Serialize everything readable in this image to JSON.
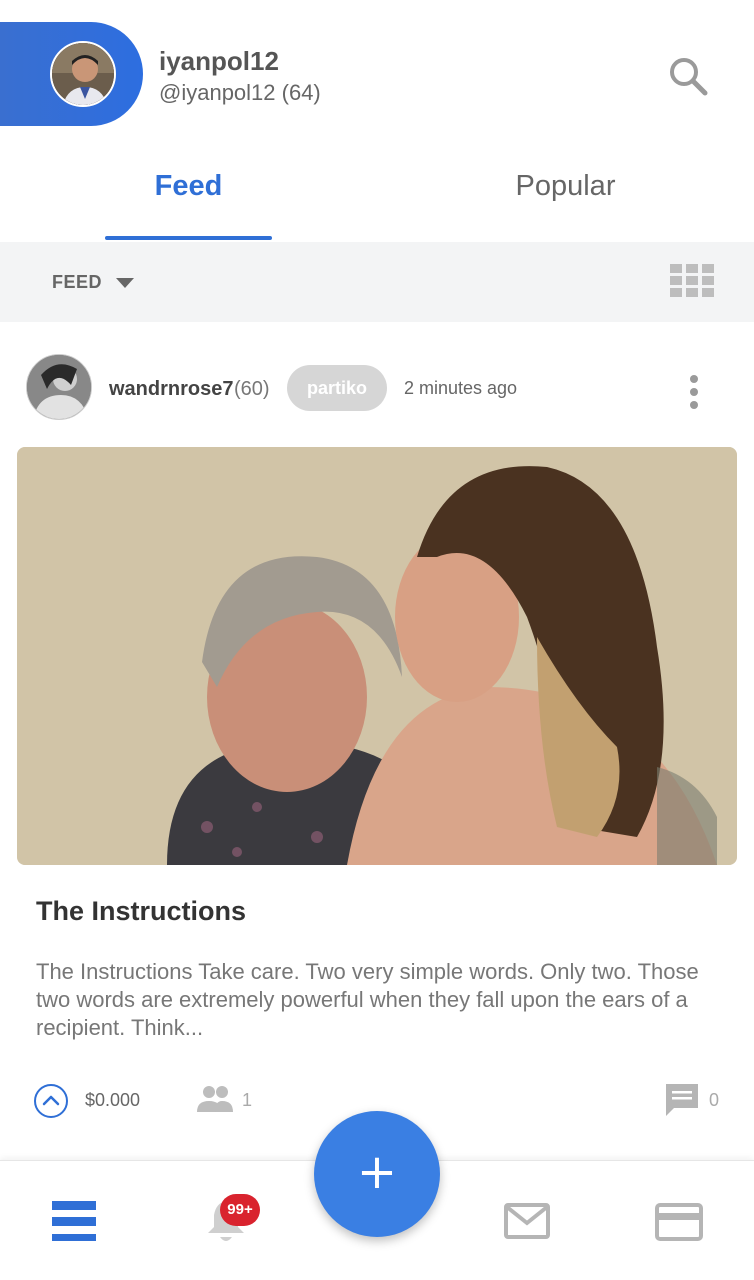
{
  "header": {
    "user_name": "iyanpol12",
    "user_handle": "@iyanpol12 (64)",
    "accent_color": "#2f6fd6"
  },
  "tabs": [
    {
      "label": "Feed",
      "active": true
    },
    {
      "label": "Popular",
      "active": false
    }
  ],
  "filter": {
    "label": "FEED"
  },
  "post": {
    "author": "wandrnrose7",
    "reputation": "(60)",
    "tag": "partiko",
    "time": "2 minutes ago",
    "title": "The Instructions",
    "excerpt": "The Instructions Take care. Two very simple words. Only two. Those two words are extremely powerful when they fall upon the ears of a recipient. Think...",
    "payout": "$0.000",
    "voters": "1",
    "comments": "0"
  },
  "bottom_nav": {
    "notifications_badge": "99+",
    "fab_label": "+"
  }
}
